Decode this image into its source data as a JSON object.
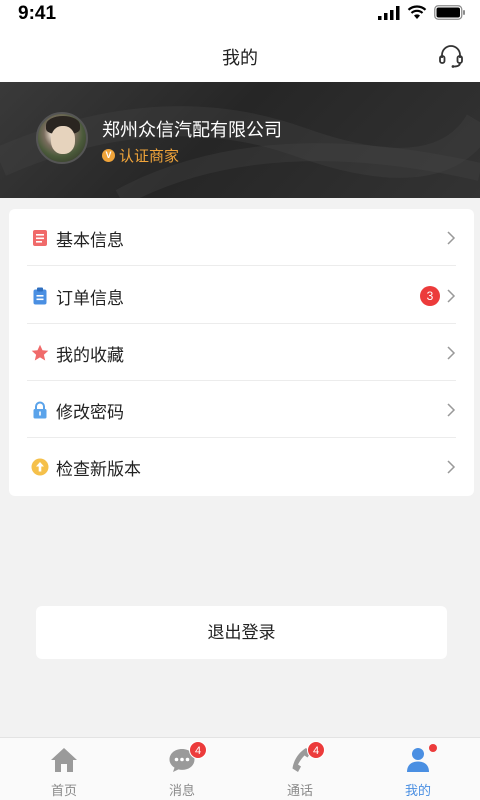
{
  "status_bar": {
    "time": "9:41"
  },
  "header": {
    "title": "我的"
  },
  "profile": {
    "company_name": "郑州众信汽配有限公司",
    "cert_mark": "V",
    "cert_label": "认证商家"
  },
  "menu": {
    "items": [
      {
        "label": "基本信息",
        "icon": "document-icon",
        "color": "#f06a6a"
      },
      {
        "label": "订单信息",
        "icon": "clipboard-icon",
        "color": "#4a8fe2",
        "badge": "3"
      },
      {
        "label": "我的收藏",
        "icon": "star-icon",
        "color": "#f06a6a"
      },
      {
        "label": "修改密码",
        "icon": "lock-icon",
        "color": "#5aa3ea"
      },
      {
        "label": "检查新版本",
        "icon": "upgrade-icon",
        "color": "#f5c04a"
      }
    ]
  },
  "logout": {
    "label": "退出登录"
  },
  "tabs": [
    {
      "label": "首页",
      "icon": "home-icon"
    },
    {
      "label": "消息",
      "icon": "message-icon",
      "badge": "4"
    },
    {
      "label": "通话",
      "icon": "phone-icon",
      "badge": "4"
    },
    {
      "label": "我的",
      "icon": "user-icon",
      "active": true
    }
  ],
  "colors": {
    "accent": "#4a8fe2",
    "badge": "#ec3b3b",
    "cert": "#f0a43a"
  }
}
